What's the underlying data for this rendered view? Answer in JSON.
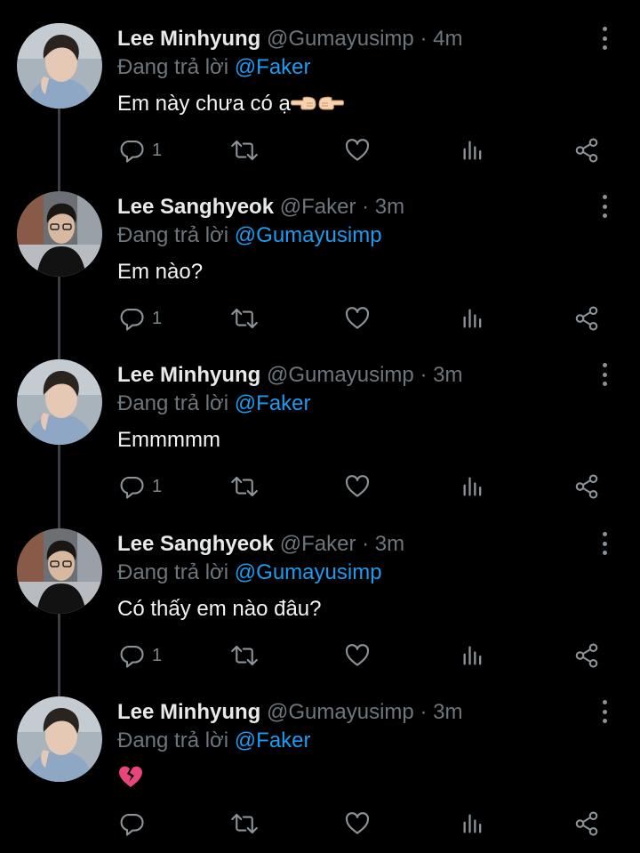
{
  "reply_prefix": "Đang trả lời",
  "tweets": [
    {
      "name": "Lee Minhyung",
      "handle": "@Gumayusimp",
      "dot": "·",
      "time": "4m",
      "reply_to": "@Faker",
      "text": "Em này chưa có ạ",
      "emoji": [
        "pointing-left-hand",
        "pointing-right-hand"
      ],
      "replies": "1",
      "avatar": "avatar-gumayusi"
    },
    {
      "name": "Lee Sanghyeok",
      "handle": "@Faker",
      "dot": "·",
      "time": "3m",
      "reply_to": "@Gumayusimp",
      "text": "Em nào?",
      "emoji": [],
      "replies": "1",
      "avatar": "avatar-faker"
    },
    {
      "name": "Lee Minhyung",
      "handle": "@Gumayusimp",
      "dot": "·",
      "time": "3m",
      "reply_to": "@Faker",
      "text": "Emmmmm",
      "emoji": [],
      "replies": "1",
      "avatar": "avatar-gumayusi"
    },
    {
      "name": "Lee Sanghyeok",
      "handle": "@Faker",
      "dot": "·",
      "time": "3m",
      "reply_to": "@Gumayusimp",
      "text": "Có thấy em nào đâu?",
      "emoji": [],
      "replies": "1",
      "avatar": "avatar-faker"
    },
    {
      "name": "Lee Minhyung",
      "handle": "@Gumayusimp",
      "dot": "·",
      "time": "3m",
      "reply_to": "@Faker",
      "text": "",
      "emoji": [
        "broken-heart"
      ],
      "replies": "",
      "avatar": "avatar-gumayusi"
    }
  ],
  "colors": {
    "background": "#000000",
    "mention": "#1d9bf0",
    "muted": "#6e767d",
    "thread_line": "#3b3f44"
  }
}
